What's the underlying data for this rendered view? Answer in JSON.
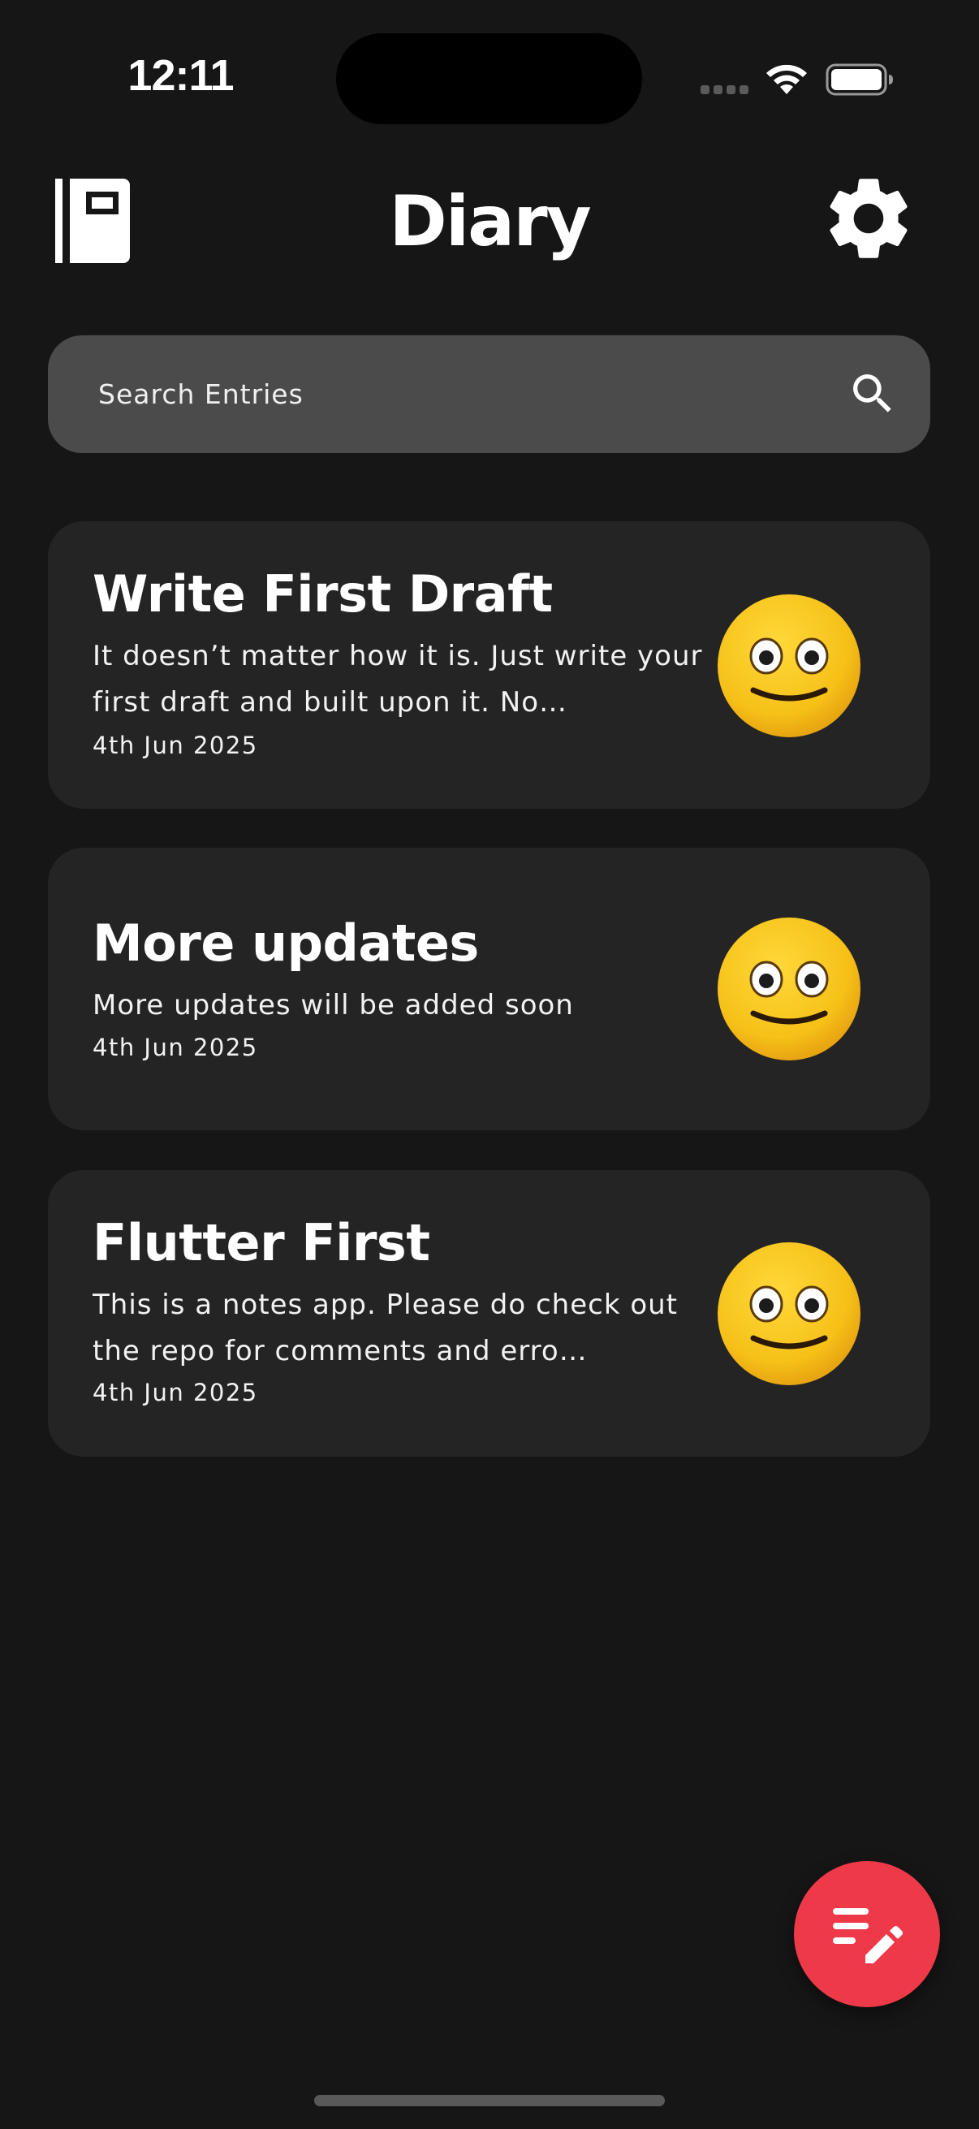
{
  "status_bar": {
    "time": "12:11",
    "icons": [
      "cellular-signal-icon",
      "wifi-icon",
      "battery-icon"
    ]
  },
  "header": {
    "title": "Diary",
    "left_icon": "notebook-icon",
    "right_icon": "gear-icon"
  },
  "search": {
    "placeholder": "Search Entries",
    "value": "",
    "icon": "search-icon"
  },
  "entries": [
    {
      "title": "Write First Draft",
      "body": "It doesn’t matter how it is. Just write your first draft and built upon it. No…",
      "date": "4th Jun 2025",
      "mood_icon": "slightly-smiling-face-icon"
    },
    {
      "title": "More updates",
      "body": "More updates will be added soon",
      "date": "4th Jun 2025",
      "mood_icon": "slightly-smiling-face-icon"
    },
    {
      "title": "Flutter First",
      "body": "This is a notes app. Please do check out the repo for comments and erro…",
      "date": "4th Jun 2025",
      "mood_icon": "slightly-smiling-face-icon"
    }
  ],
  "fab": {
    "icon": "edit-note-icon"
  },
  "colors": {
    "background": "#161616",
    "card": "#242424",
    "search_bar": "#4b4b4b",
    "accent": "#ee3a48",
    "text": "#ffffff",
    "emoji_yellow": "#f9c21a"
  }
}
